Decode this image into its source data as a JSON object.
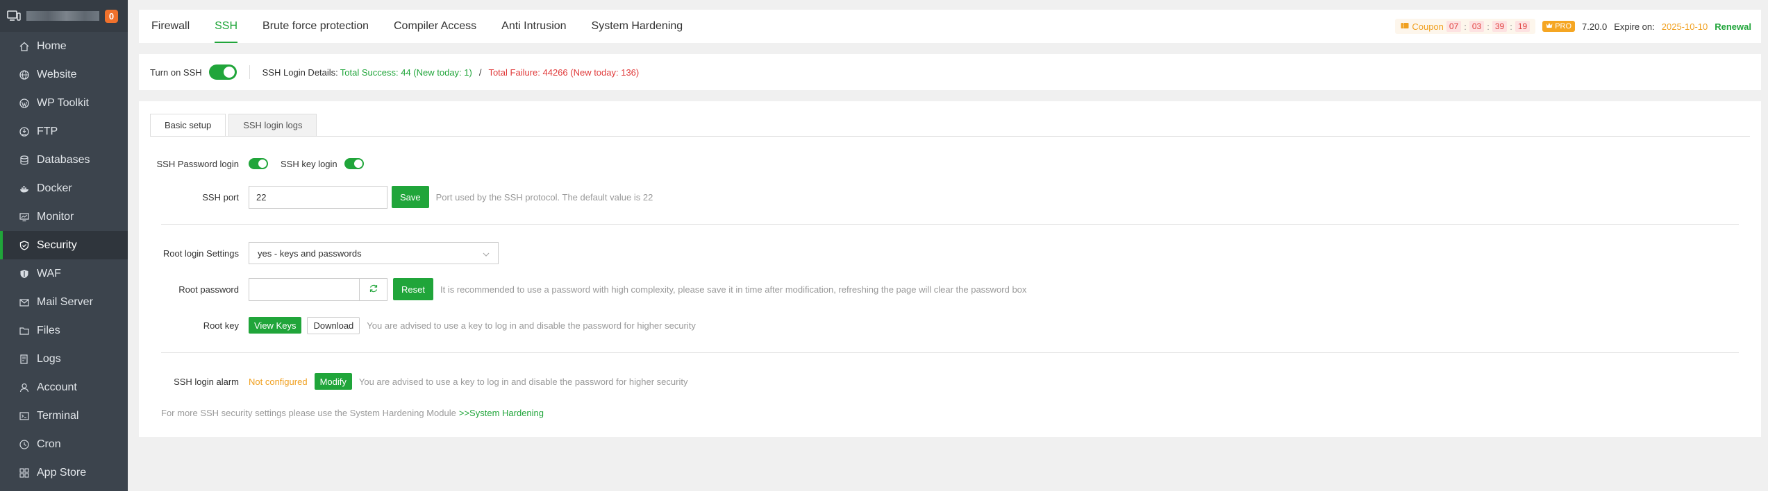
{
  "sidebar": {
    "badge": "0",
    "items": [
      {
        "label": "Home",
        "icon": "home-icon"
      },
      {
        "label": "Website",
        "icon": "globe-icon"
      },
      {
        "label": "WP Toolkit",
        "icon": "wordpress-icon"
      },
      {
        "label": "FTP",
        "icon": "ftp-icon"
      },
      {
        "label": "Databases",
        "icon": "database-icon"
      },
      {
        "label": "Docker",
        "icon": "docker-icon"
      },
      {
        "label": "Monitor",
        "icon": "monitor-icon"
      },
      {
        "label": "Security",
        "icon": "shield-icon",
        "active": true
      },
      {
        "label": "WAF",
        "icon": "waf-shield-icon"
      },
      {
        "label": "Mail Server",
        "icon": "mail-icon"
      },
      {
        "label": "Files",
        "icon": "folder-icon"
      },
      {
        "label": "Logs",
        "icon": "logs-icon"
      },
      {
        "label": "Account",
        "icon": "user-icon"
      },
      {
        "label": "Terminal",
        "icon": "terminal-icon"
      },
      {
        "label": "Cron",
        "icon": "clock-icon"
      },
      {
        "label": "App Store",
        "icon": "grid-icon"
      }
    ]
  },
  "topbar": {
    "tabs": [
      "Firewall",
      "SSH",
      "Brute force protection",
      "Compiler Access",
      "Anti Intrusion",
      "System Hardening"
    ],
    "active_tab": "SSH",
    "coupon_label": "Coupon",
    "countdown": [
      "07",
      "03",
      "39",
      "19"
    ],
    "pro_label": "PRO",
    "version": "7.20.0",
    "expire_label": "Expire on:",
    "expire_date": "2025-10-10",
    "renewal": "Renewal"
  },
  "status": {
    "turn_on_label": "Turn on SSH",
    "details_label": "SSH Login Details:",
    "total_success": "Total Success: 44 (New today: 1)",
    "slash": "/",
    "total_failure": "Total Failure: 44266 (New today: 136)"
  },
  "panel": {
    "subtabs": [
      "Basic setup",
      "SSH login logs"
    ],
    "password_login_label": "SSH Password login",
    "key_login_label": "SSH key login",
    "port_label": "SSH port",
    "port_value": "22",
    "save_label": "Save",
    "port_hint": "Port used by the SSH protocol. The default value is 22",
    "root_login_label": "Root login Settings",
    "root_login_value": "yes - keys and passwords",
    "root_password_label": "Root password",
    "reset_label": "Reset",
    "root_password_hint": "It is recommended to use a password with high complexity, please save it in time after modification, refreshing the page will clear the password box",
    "root_key_label": "Root key",
    "view_keys_label": "View Keys",
    "download_label": "Download",
    "root_key_hint": "You are advised to use a key to log in and disable the password for higher security",
    "alarm_label": "SSH login alarm",
    "alarm_status": "Not configured",
    "modify_label": "Modify",
    "alarm_hint": "You are advised to use a key to log in and disable the password for higher security",
    "footer_text": "For more SSH security settings please use the System Hardening Module",
    "footer_link": ">>System Hardening"
  },
  "colors": {
    "accent": "#20a53a",
    "danger": "#e03a3a",
    "warning": "#f0a020",
    "sidebar_bg": "#3c444d"
  }
}
